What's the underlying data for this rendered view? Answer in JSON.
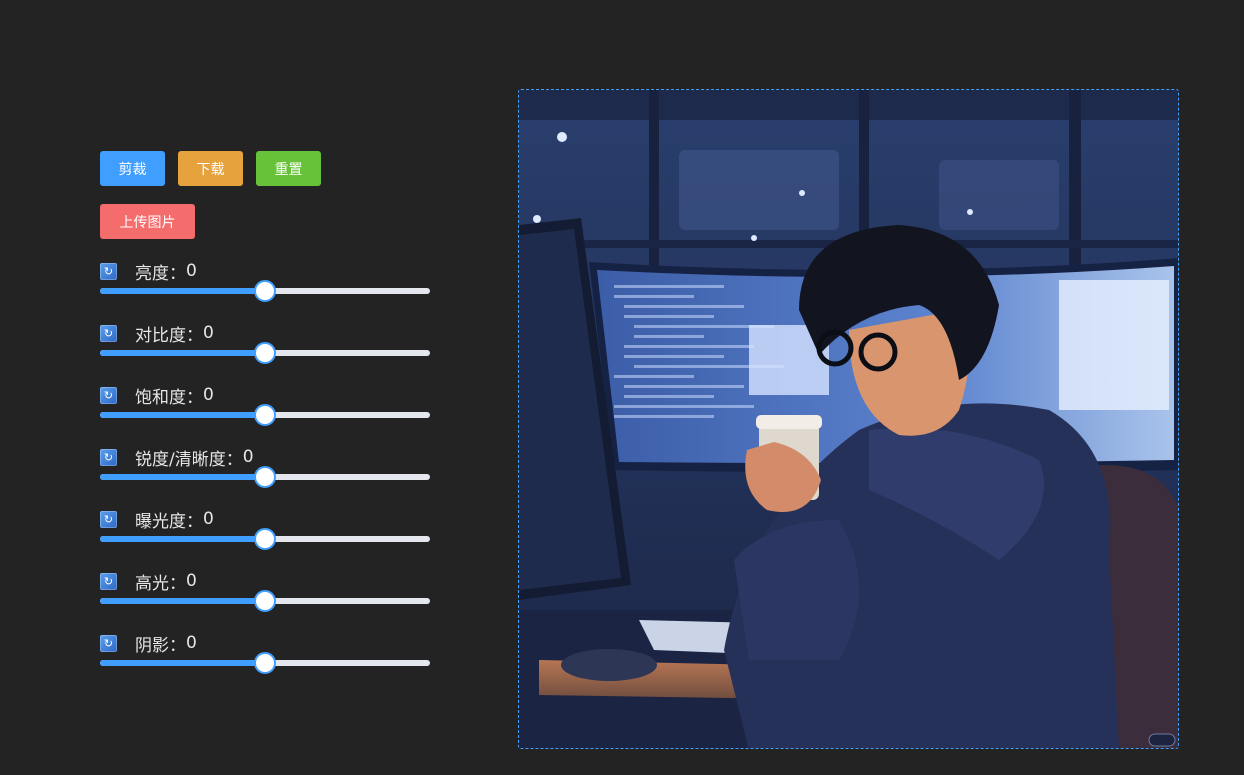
{
  "toolbar": {
    "crop_label": "剪裁",
    "download_label": "下载",
    "reset_label": "重置",
    "upload_label": "上传图片"
  },
  "adjustments": [
    {
      "name": "亮度",
      "label": "亮度：",
      "value": 0,
      "fraction": 0.5
    },
    {
      "name": "对比度",
      "label": "对比度：",
      "value": 0,
      "fraction": 0.5
    },
    {
      "name": "饱和度",
      "label": "饱和度：",
      "value": 0,
      "fraction": 0.5
    },
    {
      "name": "锐度/清晰度",
      "label": "锐度/清晰度：",
      "value": 0,
      "fraction": 0.5
    },
    {
      "name": "曝光度",
      "label": "曝光度：",
      "value": 0,
      "fraction": 0.5
    },
    {
      "name": "高光",
      "label": "高光：",
      "value": 0,
      "fraction": 0.5
    },
    {
      "name": "阴影",
      "label": "阴影：",
      "value": 0,
      "fraction": 0.5
    }
  ],
  "icons": {
    "reset": "refresh-icon"
  },
  "colors": {
    "background": "#232323",
    "accent": "#409eff",
    "crop": "#409eff",
    "download": "#e6a23c",
    "reset": "#67c23a",
    "upload": "#f56c6c"
  }
}
